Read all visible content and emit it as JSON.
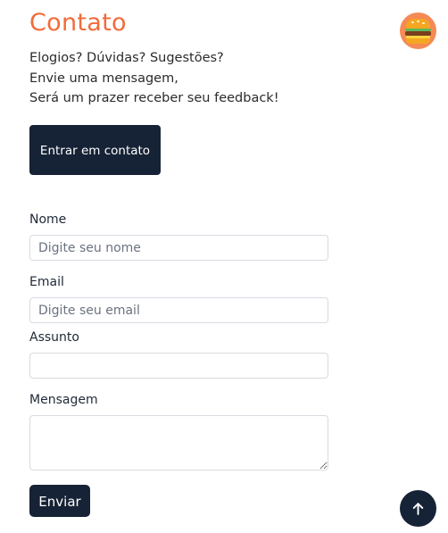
{
  "header": {
    "title": "Contato",
    "logo_icon": "burger-icon"
  },
  "intro": {
    "line1": "Elogios? Dúvidas? Sugestões?",
    "line2": "Envie uma mensagem,",
    "line3": "Será um prazer receber seu feedback!"
  },
  "contact_button": {
    "label": "Entrar em contato"
  },
  "form": {
    "name": {
      "label": "Nome",
      "placeholder": "Digite seu nome",
      "value": ""
    },
    "email": {
      "label": "Email",
      "placeholder": "Digite seu email",
      "value": ""
    },
    "subject": {
      "label": "Assunto",
      "placeholder": "",
      "value": ""
    },
    "message": {
      "label": "Mensagem",
      "placeholder": "",
      "value": ""
    },
    "submit_label": "Enviar"
  },
  "scroll_top": {
    "icon": "arrow-up-icon"
  },
  "colors": {
    "accent": "#f26b3a",
    "primary": "#162235",
    "logo_bg": "#f58a55"
  }
}
